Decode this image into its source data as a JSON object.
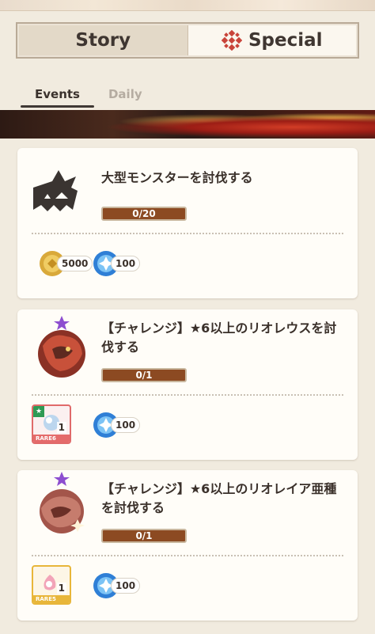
{
  "mode_switch": {
    "story_label": "Story",
    "special_label": "Special",
    "active": "Special"
  },
  "tabs": [
    {
      "label": "Events",
      "active": true
    },
    {
      "label": "Daily",
      "active": false
    }
  ],
  "quests": [
    {
      "title": "大型モンスターを討伐する",
      "progress_text": "0/20",
      "progress_value": 0,
      "icon": "large-monster-icon",
      "rewards": [
        {
          "type": "zenny",
          "icon": "zenny-coin-icon",
          "count": "5000"
        },
        {
          "type": "points",
          "icon": "event-point-icon",
          "count": "100"
        }
      ]
    },
    {
      "title": "【チャレンジ】★6以上のリオレウスを討伐する",
      "progress_text": "0/1",
      "progress_value": 0,
      "icon": "rathalos-icon",
      "rewards": [
        {
          "type": "item",
          "icon": "material-icon",
          "rarity": "RARE6",
          "count": "1"
        },
        {
          "type": "points",
          "icon": "event-point-icon",
          "count": "100"
        }
      ]
    },
    {
      "title": "【チャレンジ】★6以上のリオレイア亜種を討伐する",
      "progress_text": "0/1",
      "progress_value": 0,
      "icon": "pink-rathian-icon",
      "rewards": [
        {
          "type": "item",
          "icon": "material-icon",
          "rarity": "RARE5",
          "count": "1"
        },
        {
          "type": "points",
          "icon": "event-point-icon",
          "count": "100"
        }
      ]
    }
  ],
  "colors": {
    "background": "#f1ebdf",
    "progress_track": "#8c4a22",
    "rare6": "#e46b6b",
    "rare5": "#e8b63a",
    "special_accent": "#c9443a"
  }
}
